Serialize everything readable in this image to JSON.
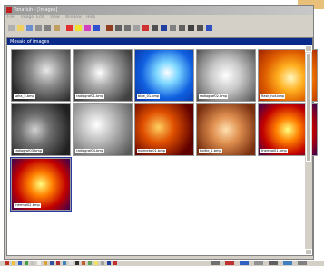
{
  "app": {
    "title": "Tonatiuh - [Images]",
    "icon": "app-icon"
  },
  "menu": [
    "File",
    "Image",
    "Edit",
    "View",
    "Window",
    "Help"
  ],
  "toolbar": {
    "icons": [
      "new-icon",
      "open-icon",
      "save-icon",
      "print-icon",
      "grid-icon",
      "palette-icon",
      "color-red-icon",
      "color-yellow-icon",
      "color-magenta-icon",
      "color-blue-icon",
      "brush-icon",
      "rectangle-icon",
      "select-icon",
      "lasso-icon",
      "pencil-icon",
      "arrow-icon",
      "zoom-icon",
      "crop-icon",
      "rotate-icon",
      "undo-icon",
      "redo-icon",
      "help-icon"
    ]
  },
  "panel": {
    "title": "Mosaic of images"
  },
  "thumbnails": [
    {
      "label": "saha_5.bmp",
      "style": "dark-grey",
      "selected": false
    },
    {
      "label": "radiograf01.bmp",
      "style": "grey",
      "selected": false
    },
    {
      "label": "blue_01.bmp",
      "style": "blue",
      "selected": false
    },
    {
      "label": "radiograf02.bmp",
      "style": "light-grey",
      "selected": false
    },
    {
      "label": "flask_hot.bmp",
      "style": "hot",
      "selected": false
    },
    {
      "label": "radiograf03.bmp",
      "style": "dark-grey-2",
      "selected": false
    },
    {
      "label": "radiograf04.bmp",
      "style": "silver",
      "selected": false
    },
    {
      "label": "hotmetal01.bmp",
      "style": "hot-dark",
      "selected": false
    },
    {
      "label": "bottle_1.bmp",
      "style": "copper",
      "selected": false
    },
    {
      "label": "thermal01.bmp",
      "style": "thermal",
      "selected": false
    },
    {
      "label": "thermal02.bmp",
      "style": "thermal",
      "selected": true
    }
  ],
  "colors": {
    "panel_title_bg": "#0a2a8a",
    "window_face": "#d4d0c8"
  }
}
